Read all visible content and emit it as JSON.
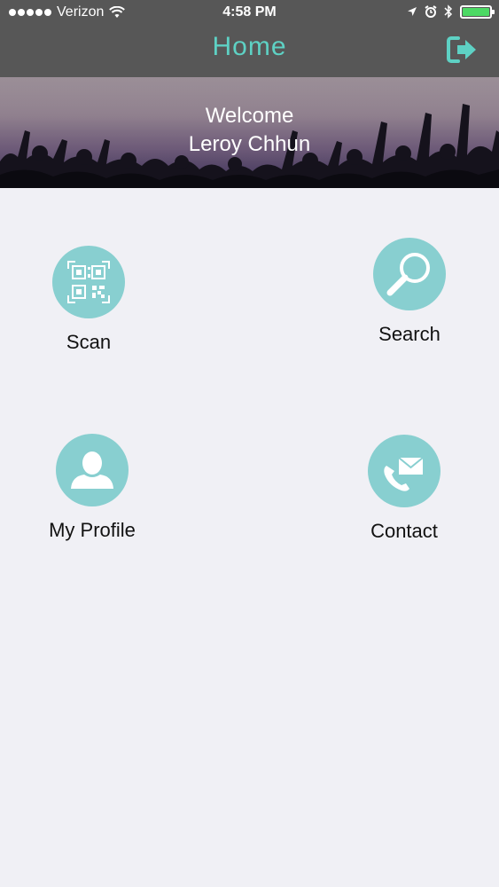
{
  "status_bar": {
    "carrier": "Verizon",
    "time": "4:58 PM"
  },
  "nav": {
    "title": "Home",
    "logout_icon": "logout-icon"
  },
  "banner": {
    "welcome_line": "Welcome",
    "user_name": "Leroy Chhun"
  },
  "menu": {
    "scan": {
      "label": "Scan",
      "icon": "qr-code-icon"
    },
    "search": {
      "label": "Search",
      "icon": "magnifier-icon"
    },
    "profile": {
      "label": "My Profile",
      "icon": "user-icon"
    },
    "contact": {
      "label": "Contact",
      "icon": "phone-mail-icon"
    }
  },
  "colors": {
    "accent": "#5ed1c4",
    "circle": "#88cfd0",
    "navbar": "#575757",
    "background": "#f0f0f5"
  }
}
